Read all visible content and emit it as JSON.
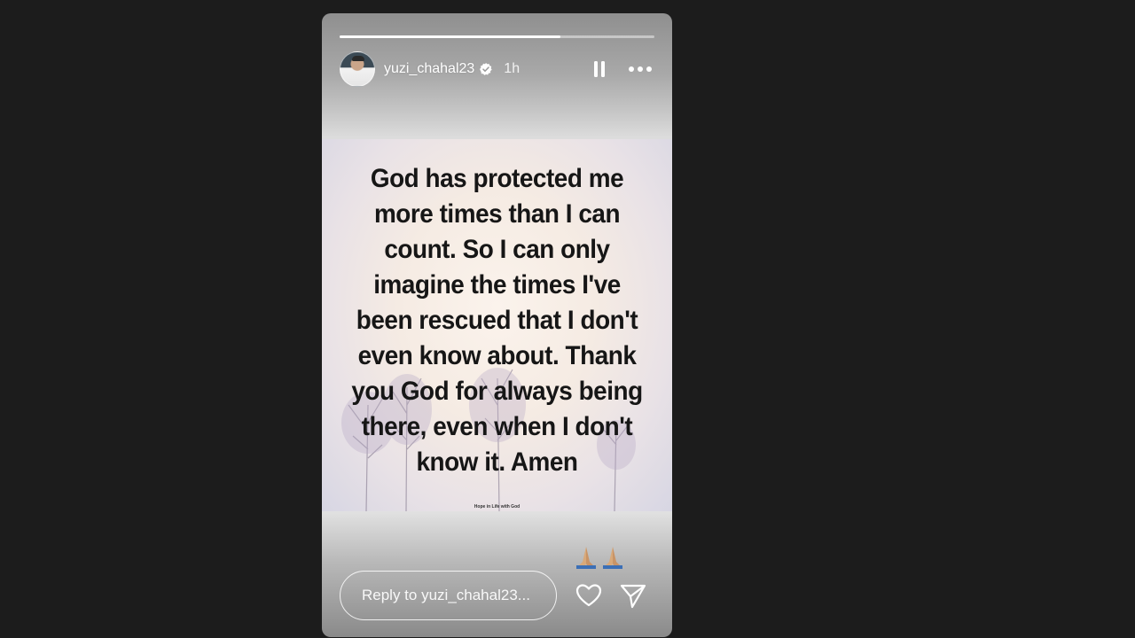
{
  "story": {
    "username": "yuzi_chahal23",
    "verified": true,
    "time_ago": "1h",
    "progress": 0.7,
    "quote_lines": [
      "God has protected me",
      "more times than I can",
      "count. So I can only",
      "imagine the times I've",
      "been rescued that I don't",
      "even know about. Thank",
      "you God for always being",
      "there, even when I don't",
      "know it. Amen"
    ],
    "watermark": "Hope in Life with God",
    "reaction_emoji": "🙏🏽🙏🏽",
    "reply_placeholder": "Reply to yuzi_chahal23..."
  },
  "icons": {
    "pause": "pause-icon",
    "more": "more-horizontal-icon",
    "verified": "verified-badge-icon",
    "like": "heart-icon",
    "share": "send-icon"
  },
  "colors": {
    "background": "#1c1c1c",
    "text_on_story": "#ffffff",
    "quote_text": "#161616",
    "verified_badge": "#ffffff"
  }
}
